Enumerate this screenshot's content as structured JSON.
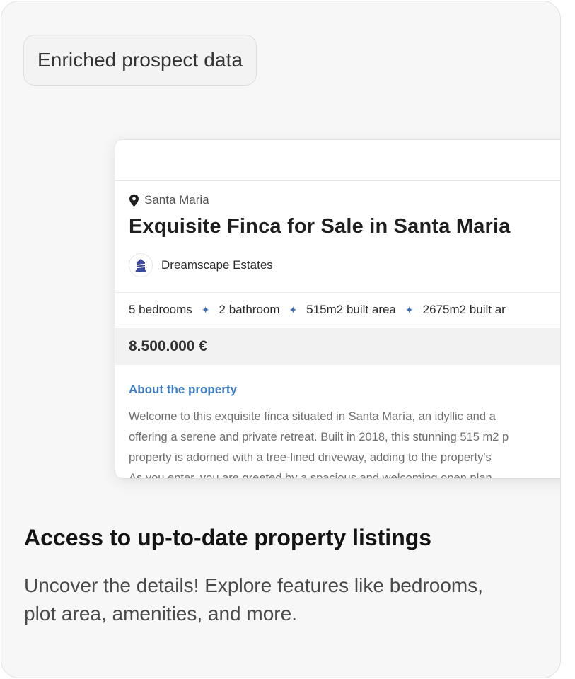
{
  "card": {
    "badge": "Enriched prospect data",
    "headline": "Access to up-to-date property listings",
    "description_lines": [
      "Uncover the details! Explore features like bedrooms,",
      "plot area, amenities, and more."
    ]
  },
  "listing": {
    "location": "Santa Maria",
    "title": "Exquisite Finca for Sale in Santa Maria",
    "agency": "Dreamscape Estates",
    "features": [
      "5 bedrooms",
      "2 bathroom",
      "515m2 built area",
      "2675m2 built ar"
    ],
    "price": "8.500.000 €",
    "about_heading": "About the property",
    "about_lines": [
      "Welcome to this exquisite finca situated in Santa María, an idyllic and a",
      "offering a serene and private retreat. Built in 2018, this stunning 515 m2 p",
      "property is adorned with a tree-lined driveway, adding to the property's",
      "As you enter, you are greeted by a spacious and welcoming open plan"
    ]
  },
  "icons": {
    "location": "map-pin-icon",
    "agency_logo": "house-logo-icon",
    "feature_separator": "sparkle-icon"
  },
  "colors": {
    "card_background": "#f7f7f7",
    "accent_blue": "#3d7cc4",
    "agency_logo": "#3b4a9a"
  }
}
